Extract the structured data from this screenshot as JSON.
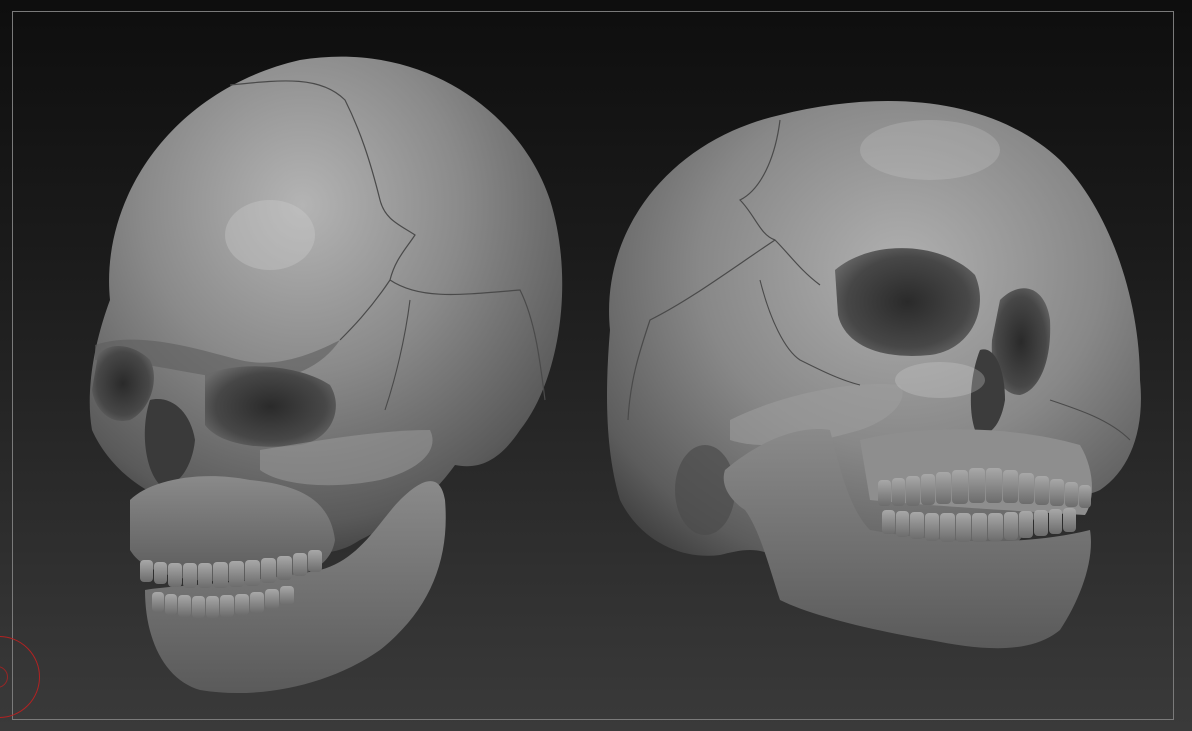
{
  "viewport": {
    "background_top": "#0e0e0e",
    "background_bottom": "#3a3a3a",
    "frame_color": "#7a7a7a"
  },
  "models": [
    {
      "name": "skull-left",
      "material_color": "#8c8c8c"
    },
    {
      "name": "skull-right",
      "material_color": "#8c8c8c"
    }
  ],
  "brush_cursor": {
    "color": "#b22222"
  }
}
